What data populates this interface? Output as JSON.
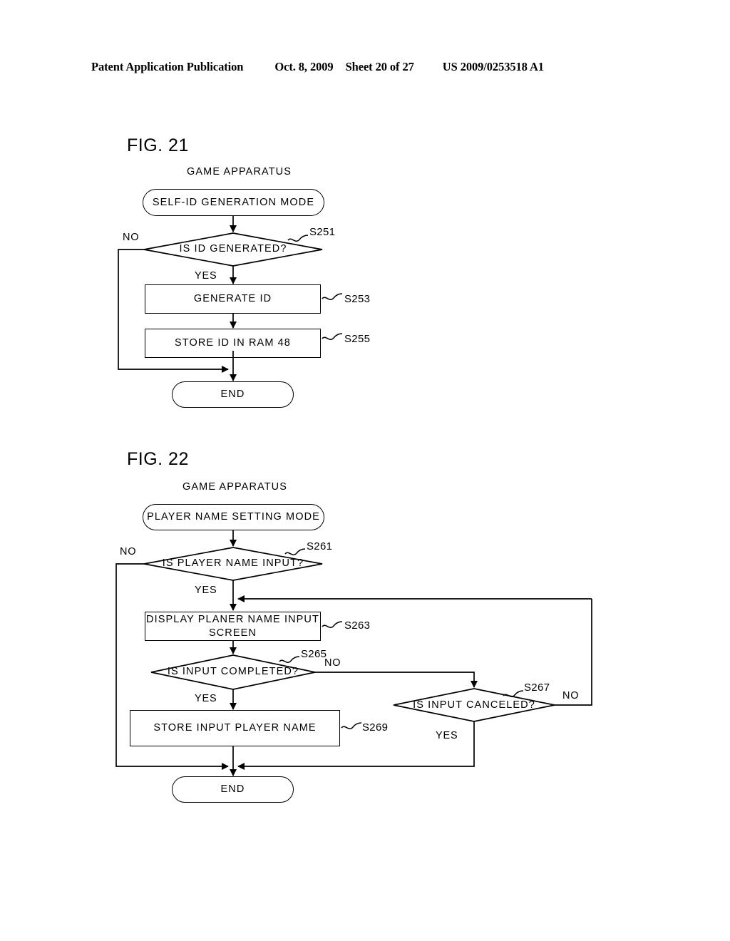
{
  "header": {
    "publication": "Patent Application Publication",
    "date": "Oct. 8, 2009",
    "sheet": "Sheet 20 of 27",
    "doc_number": "US 2009/0253518 A1"
  },
  "figures": [
    {
      "id": "fig21",
      "title": "FIG. 21",
      "caption": "GAME APPARATUS",
      "start": "SELF-ID GENERATION MODE",
      "end": "END",
      "nodes": {
        "s251": {
          "text": "IS ID GENERATED?",
          "step": "S251",
          "type": "decision"
        },
        "s253": {
          "text": "GENERATE ID",
          "step": "S253",
          "type": "process"
        },
        "s255": {
          "text": "STORE ID IN RAM 48",
          "step": "S255",
          "type": "process"
        }
      },
      "branches": {
        "s251_no": "NO",
        "s251_yes": "YES"
      }
    },
    {
      "id": "fig22",
      "title": "FIG. 22",
      "caption": "GAME APPARATUS",
      "start": "PLAYER NAME SETTING MODE",
      "end": "END",
      "nodes": {
        "s261": {
          "text": "IS PLAYER NAME INPUT?",
          "step": "S261",
          "type": "decision"
        },
        "s263": {
          "text": "DISPLAY PLANER NAME INPUT\nSCREEN",
          "step": "S263",
          "type": "process"
        },
        "s265": {
          "text": "IS INPUT COMPLETED?",
          "step": "S265",
          "type": "decision"
        },
        "s267": {
          "text": "IS INPUT CANCELED?",
          "step": "S267",
          "type": "decision"
        },
        "s269": {
          "text": "STORE INPUT PLAYER NAME",
          "step": "S269",
          "type": "process"
        }
      },
      "branches": {
        "s261_no": "NO",
        "s261_yes": "YES",
        "s265_no": "NO",
        "s265_yes": "YES",
        "s267_no": "NO",
        "s267_yes": "YES"
      }
    }
  ],
  "colors": {
    "ink": "#000000",
    "page": "#ffffff"
  }
}
